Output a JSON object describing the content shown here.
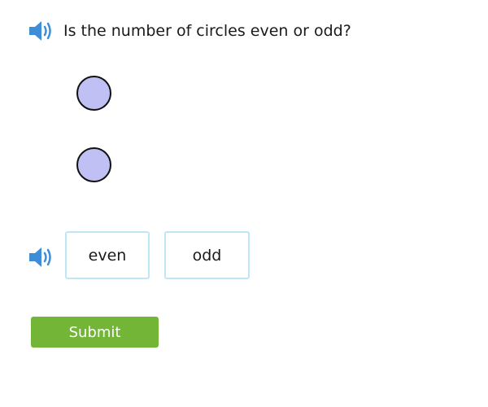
{
  "question": {
    "text": "Is the number of circles even or odd?",
    "audio_icon": "speaker-icon"
  },
  "figure": {
    "circle_count": 2,
    "circle_fill": "#c0c0f4",
    "circle_stroke": "#111111"
  },
  "answers": {
    "audio_icon": "speaker-icon",
    "options": [
      {
        "label": "even"
      },
      {
        "label": "odd"
      }
    ],
    "border_color": "#bfe6f5"
  },
  "submit": {
    "label": "Submit",
    "color": "#72b537"
  },
  "colors": {
    "speaker": "#3d8ed6"
  }
}
